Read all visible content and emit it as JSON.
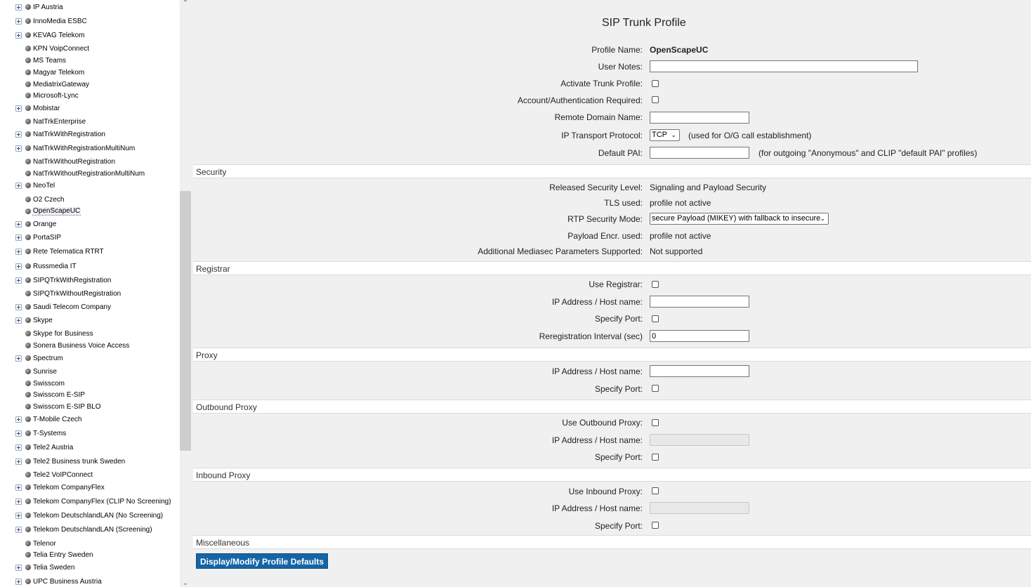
{
  "sidebar": {
    "items": [
      {
        "label": "IP Austria",
        "expandable": true
      },
      {
        "label": "InnoMedia ESBC",
        "expandable": true
      },
      {
        "label": "KEVAG Telekom",
        "expandable": true
      },
      {
        "label": "KPN VoipConnect",
        "expandable": false
      },
      {
        "label": "MS Teams",
        "expandable": false
      },
      {
        "label": "Magyar Telekom",
        "expandable": false
      },
      {
        "label": "MediatrixGateway",
        "expandable": false
      },
      {
        "label": "Microsoft-Lync",
        "expandable": false
      },
      {
        "label": "Mobistar",
        "expandable": true
      },
      {
        "label": "NatTrkEnterprise",
        "expandable": false
      },
      {
        "label": "NatTrkWithRegistration",
        "expandable": true
      },
      {
        "label": "NatTrkWithRegistrationMultiNum",
        "expandable": true
      },
      {
        "label": "NatTrkWithoutRegistration",
        "expandable": false
      },
      {
        "label": "NatTrkWithoutRegistrationMultiNum",
        "expandable": false
      },
      {
        "label": "NeoTel",
        "expandable": true
      },
      {
        "label": "O2 Czech",
        "expandable": false
      },
      {
        "label": "OpenScapeUC",
        "expandable": false,
        "selected": true
      },
      {
        "label": "Orange",
        "expandable": true
      },
      {
        "label": "PortaSIP",
        "expandable": true
      },
      {
        "label": "Rete Telematica RTRT",
        "expandable": true
      },
      {
        "label": "Russmedia IT",
        "expandable": true
      },
      {
        "label": "SIPQTrkWithRegistration",
        "expandable": true
      },
      {
        "label": "SIPQTrkWithoutRegistration",
        "expandable": false
      },
      {
        "label": "Saudi Telecom Company",
        "expandable": true
      },
      {
        "label": "Skype",
        "expandable": true
      },
      {
        "label": "Skype for Business",
        "expandable": false
      },
      {
        "label": "Sonera Business Voice Access",
        "expandable": false
      },
      {
        "label": "Spectrum",
        "expandable": true
      },
      {
        "label": "Sunrise",
        "expandable": false
      },
      {
        "label": "Swisscom",
        "expandable": false
      },
      {
        "label": "Swisscom E-SIP",
        "expandable": false
      },
      {
        "label": "Swisscom E-SIP BLO",
        "expandable": false
      },
      {
        "label": "T-Mobile Czech",
        "expandable": true
      },
      {
        "label": "T-Systems",
        "expandable": true
      },
      {
        "label": "Tele2 Austria",
        "expandable": true
      },
      {
        "label": "Tele2 Business trunk Sweden",
        "expandable": true
      },
      {
        "label": "Tele2 VoIPConnect",
        "expandable": false
      },
      {
        "label": "Telekom CompanyFlex",
        "expandable": true
      },
      {
        "label": "Telekom CompanyFlex (CLIP No Screening)",
        "expandable": true
      },
      {
        "label": "Telekom DeutschlandLAN (No Screening)",
        "expandable": true
      },
      {
        "label": "Telekom DeutschlandLAN (Screening)",
        "expandable": true
      },
      {
        "label": "Telenor",
        "expandable": false
      },
      {
        "label": "Telia Entry Sweden",
        "expandable": false
      },
      {
        "label": "Telia Sweden",
        "expandable": true
      },
      {
        "label": "UPC Business Austria",
        "expandable": true
      }
    ]
  },
  "main": {
    "title": "SIP Trunk Profile",
    "profile_name_label": "Profile Name:",
    "profile_name_value": "OpenScapeUC",
    "user_notes_label": "User Notes:",
    "user_notes_value": "",
    "activate_label": "Activate Trunk Profile:",
    "auth_required_label": "Account/Authentication Required:",
    "remote_domain_label": "Remote Domain Name:",
    "remote_domain_value": "",
    "transport_label": "IP Transport Protocol:",
    "transport_value": "TCP",
    "transport_note": "(used for O/G call establishment)",
    "default_pai_label": "Default PAI:",
    "default_pai_value": "",
    "default_pai_note": "(for outgoing \"Anonymous\" and CLIP \"default PAI\" profiles)"
  },
  "security": {
    "header": "Security",
    "released_level_label": "Released Security Level:",
    "released_level_value": "Signaling and Payload Security",
    "tls_label": "TLS used:",
    "tls_value": "profile not active",
    "rtp_mode_label": "RTP Security Mode:",
    "rtp_mode_value": "secure Payload (MIKEY) with fallback to insecure",
    "payload_encr_label": "Payload Encr. used:",
    "payload_encr_value": "profile not active",
    "mediasec_label": "Additional Mediasec Parameters Supported:",
    "mediasec_value": "Not supported"
  },
  "registrar": {
    "header": "Registrar",
    "use_label": "Use Registrar:",
    "ip_label": "IP Address / Host name:",
    "ip_value": "",
    "port_label": "Specify Port:",
    "interval_label": "Reregistration Interval (sec)",
    "interval_value": "0"
  },
  "proxy": {
    "header": "Proxy",
    "ip_label": "IP Address / Host name:",
    "ip_value": "",
    "port_label": "Specify Port:"
  },
  "outbound_proxy": {
    "header": "Outbound Proxy",
    "use_label": "Use Outbound Proxy:",
    "ip_label": "IP Address / Host name:",
    "port_label": "Specify Port:"
  },
  "inbound_proxy": {
    "header": "Inbound Proxy",
    "use_label": "Use Inbound Proxy:",
    "ip_label": "IP Address / Host name:",
    "port_label": "Specify Port:"
  },
  "misc": {
    "header": "Miscellaneous",
    "defaults_button": "Display/Modify Profile Defaults"
  }
}
